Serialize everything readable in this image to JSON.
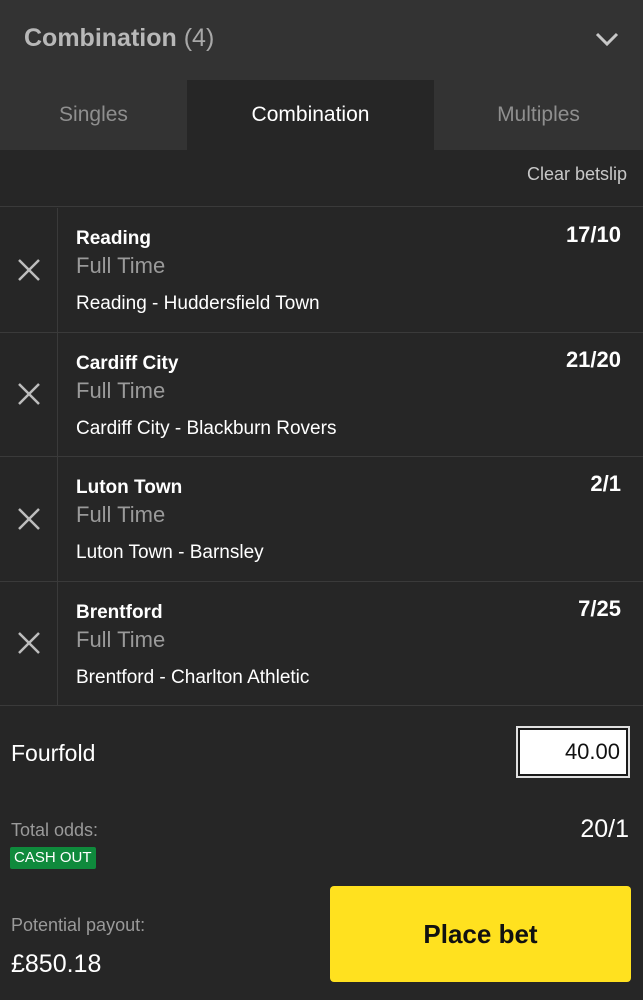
{
  "header": {
    "title": "Combination",
    "count": "(4)",
    "collapse_icon": "chevron-down-icon"
  },
  "tabs": [
    {
      "label": "Singles",
      "active": false
    },
    {
      "label": "Combination",
      "active": true
    },
    {
      "label": "Multiples",
      "active": false
    }
  ],
  "clear_betslip": "Clear betslip",
  "selections": [
    {
      "team": "Reading",
      "market": "Full Time",
      "event": "Reading - Huddersfield Town",
      "odds": "17/10",
      "remove_icon": "close-icon"
    },
    {
      "team": "Cardiff City",
      "market": "Full Time",
      "event": "Cardiff City - Blackburn Rovers",
      "odds": "21/20",
      "remove_icon": "close-icon"
    },
    {
      "team": "Luton Town",
      "market": "Full Time",
      "event": "Luton Town - Barnsley",
      "odds": "2/1",
      "remove_icon": "close-icon"
    },
    {
      "team": "Brentford",
      "market": "Full Time",
      "event": "Brentford - Charlton Athletic",
      "odds": "7/25",
      "remove_icon": "close-icon"
    }
  ],
  "bet": {
    "type_label": "Fourfold",
    "stake_value": "40.00",
    "total_odds_label": "Total odds:",
    "total_odds_value": "20/1",
    "cash_out_badge": "CASH OUT",
    "potential_payout_label": "Potential payout:",
    "potential_payout_value": "£850.18",
    "place_bet_label": "Place bet"
  },
  "colors": {
    "background": "#262626",
    "header_bg": "#333333",
    "accent_yellow": "#ffe11f",
    "cash_out_green": "#0f8a3c"
  }
}
